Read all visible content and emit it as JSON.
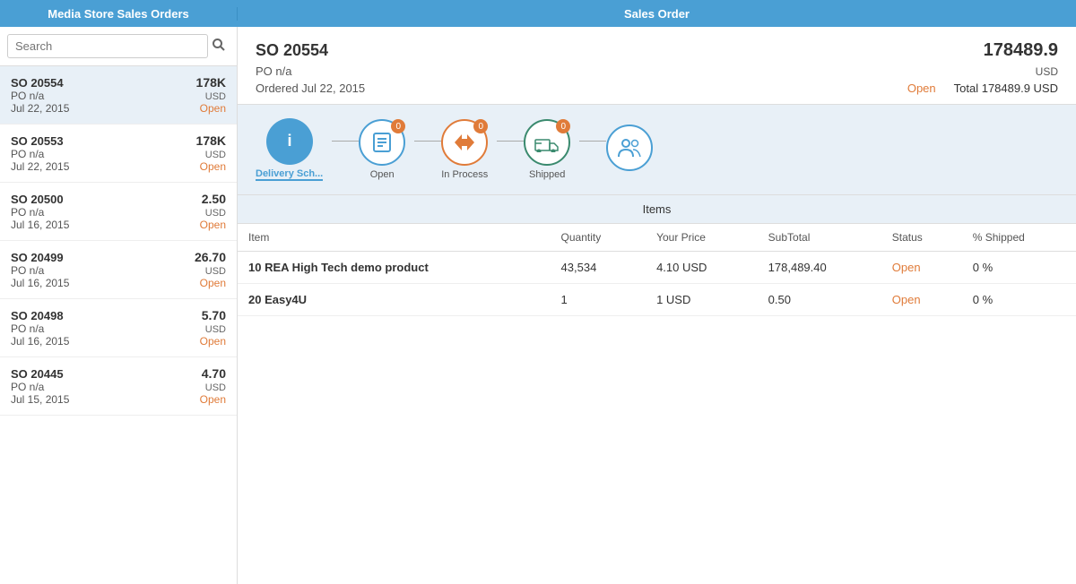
{
  "topBar": {
    "leftTitle": "Media Store Sales Orders",
    "rightTitle": "Sales Order"
  },
  "sidebar": {
    "search": {
      "placeholder": "Search",
      "value": ""
    },
    "orders": [
      {
        "id": "SO 20554",
        "amount": "178K",
        "currency": "USD",
        "po": "PO n/a",
        "status": "Open",
        "date": "Jul 22, 2015",
        "selected": true
      },
      {
        "id": "SO 20553",
        "amount": "178K",
        "currency": "USD",
        "po": "PO n/a",
        "status": "Open",
        "date": "Jul 22, 2015",
        "selected": false
      },
      {
        "id": "SO 20500",
        "amount": "2.50",
        "currency": "USD",
        "po": "PO n/a",
        "status": "Open",
        "date": "Jul 16, 2015",
        "selected": false
      },
      {
        "id": "SO 20499",
        "amount": "26.70",
        "currency": "USD",
        "po": "PO n/a",
        "status": "Open",
        "date": "Jul 16, 2015",
        "selected": false
      },
      {
        "id": "SO 20498",
        "amount": "5.70",
        "currency": "USD",
        "po": "PO n/a",
        "status": "Open",
        "date": "Jul 16, 2015",
        "selected": false
      },
      {
        "id": "SO 20445",
        "amount": "4.70",
        "currency": "USD",
        "po": "PO n/a",
        "status": "Open",
        "date": "Jul 15, 2015",
        "selected": false
      }
    ]
  },
  "detail": {
    "orderId": "SO 20554",
    "amount": "178489.9",
    "currency": "USD",
    "po": "PO n/a",
    "statusOpen": "Open",
    "ordered": "Ordered Jul 22, 2015",
    "total": "Total 178489.9 USD"
  },
  "workflow": {
    "steps": [
      {
        "id": "delivery",
        "label": "Delivery Sch...",
        "badge": null,
        "iconType": "info",
        "active": true
      },
      {
        "id": "open",
        "label": "Open",
        "badge": "0",
        "iconType": "open",
        "active": false
      },
      {
        "id": "inprocess",
        "label": "In Process",
        "badge": "0",
        "iconType": "inprocess",
        "active": false
      },
      {
        "id": "shipped",
        "label": "Shipped",
        "badge": "0",
        "iconType": "shipped",
        "active": false
      },
      {
        "id": "people",
        "label": "",
        "badge": null,
        "iconType": "people",
        "active": false
      }
    ]
  },
  "items": {
    "title": "Items",
    "columns": [
      "Item",
      "Quantity",
      "Your Price",
      "SubTotal",
      "Status",
      "% Shipped"
    ],
    "rows": [
      {
        "lineNo": "10",
        "name": "REA High Tech demo product",
        "quantity": "43,534",
        "price": "4.10 USD",
        "subTotal": "178,489.40",
        "status": "Open",
        "pctShipped": "0 %"
      },
      {
        "lineNo": "20",
        "name": "Easy4U",
        "quantity": "1",
        "price": "1 USD",
        "subTotal": "0.50",
        "status": "Open",
        "pctShipped": "0 %"
      }
    ]
  }
}
